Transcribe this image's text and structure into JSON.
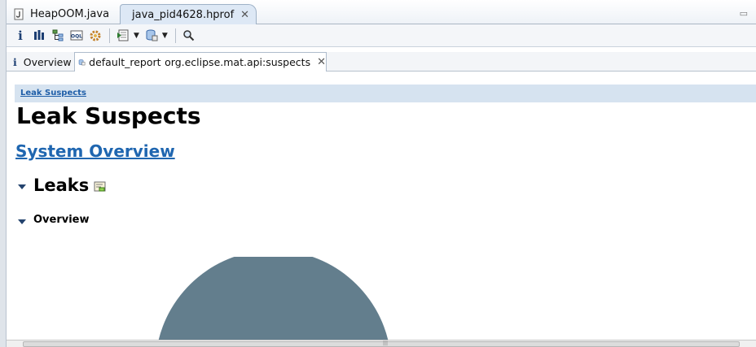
{
  "editor_tabs": [
    {
      "label": "HeapOOM.java",
      "icon": "java-file-icon"
    },
    {
      "label": "java_pid4628.hprof",
      "icon": "heap-dump-icon",
      "close": "✕"
    }
  ],
  "toolbar": {
    "info": "i",
    "histogram": "histogram-icon",
    "dominator_tree": "dominator-tree-icon",
    "oql": "OQL",
    "thread_overview": "thread-overview-icon",
    "run_report": "run-report-icon",
    "query_browser": "query-browser-icon",
    "search": "search-icon"
  },
  "sub_tabs": {
    "overview": {
      "icon": "i",
      "label": "Overview"
    },
    "report": {
      "name": "default_report",
      "id": "org.eclipse.mat.api:suspects",
      "close": "✕"
    }
  },
  "content": {
    "breadcrumb": "Leak Suspects",
    "title": "Leak Suspects",
    "system_overview": "System Overview",
    "leaks_heading": "Leaks",
    "overview_heading": "Overview"
  },
  "colors": {
    "pie_fill": "#637e8d",
    "link": "#1f66b0",
    "breadcrumb_bg": "#d6e3f0"
  }
}
